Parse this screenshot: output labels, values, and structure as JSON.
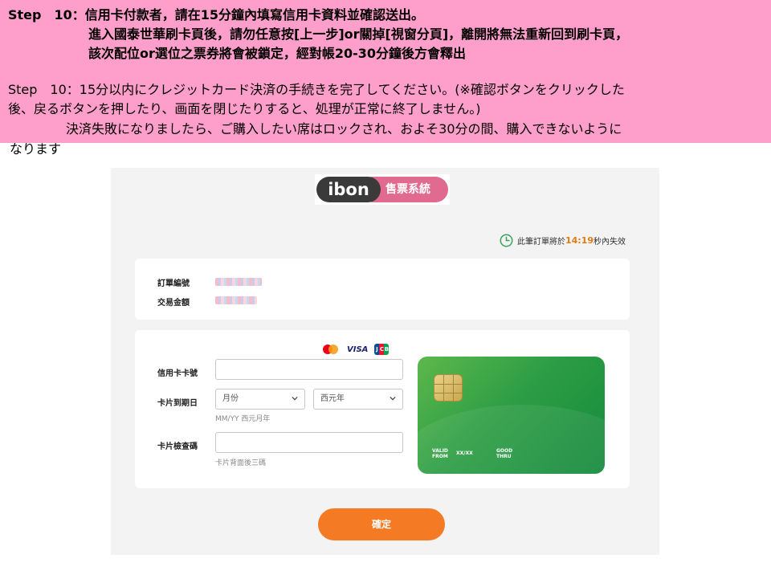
{
  "instructions": {
    "lines": [
      "Step　10：信用卡付款者，請在15分鐘內填寫信用卡資料並確認送出。",
      "進入國泰世華刷卡頁後，請勿任意按[上一步]or關掉[視窗分頁]，離開將無法重新回到刷卡頁，",
      "該次配位or選位之票券將會被鎖定，經對帳20-30分鐘後方會釋出",
      "Step　10：15分以内にクレジットカード決済の手続きを完了してください。(※確認ボタンをクリックした",
      "後、戻るボタンを押したり、画面を閉じたりすると、処理が正常に終了しません。)",
      "決済失敗になりましたら、ご購入したい席はロックされ、およそ30分の間、購入できないように",
      "なります"
    ]
  },
  "payment_page": {
    "logo": {
      "brand": "ibon",
      "system": "售票系統"
    },
    "timer": {
      "prefix": "此筆訂單將於",
      "time": "14:19",
      "suffix": "秒內失效",
      "icon": "clock-icon"
    },
    "order": {
      "order_no_label": "訂單編號",
      "amount_label": "交易金額"
    },
    "card_brands": {
      "visa": "VISA",
      "jcb": [
        "J",
        "C",
        "B"
      ]
    },
    "form": {
      "card_number_label": "信用卡卡號",
      "card_number_value": "",
      "expiry_label": "卡片到期日",
      "month_selected": "月份",
      "year_selected": "西元年",
      "expiry_hint": "MM/YY 西元月年",
      "cvv_label": "卡片檢查碼",
      "cvv_value": "",
      "cvv_hint": "卡片背面後三碼"
    },
    "card_preview": {
      "valid_from": "VALID\nFROM",
      "date": "XX/XX",
      "good_thru": "GOOD\nTHRU",
      "color": "#2e9e45"
    },
    "confirm_label": "確定",
    "colors": {
      "accent_orange": "#f47a23",
      "banner_pink": "#fe9fcb",
      "logo_pink": "#e06a90"
    }
  }
}
